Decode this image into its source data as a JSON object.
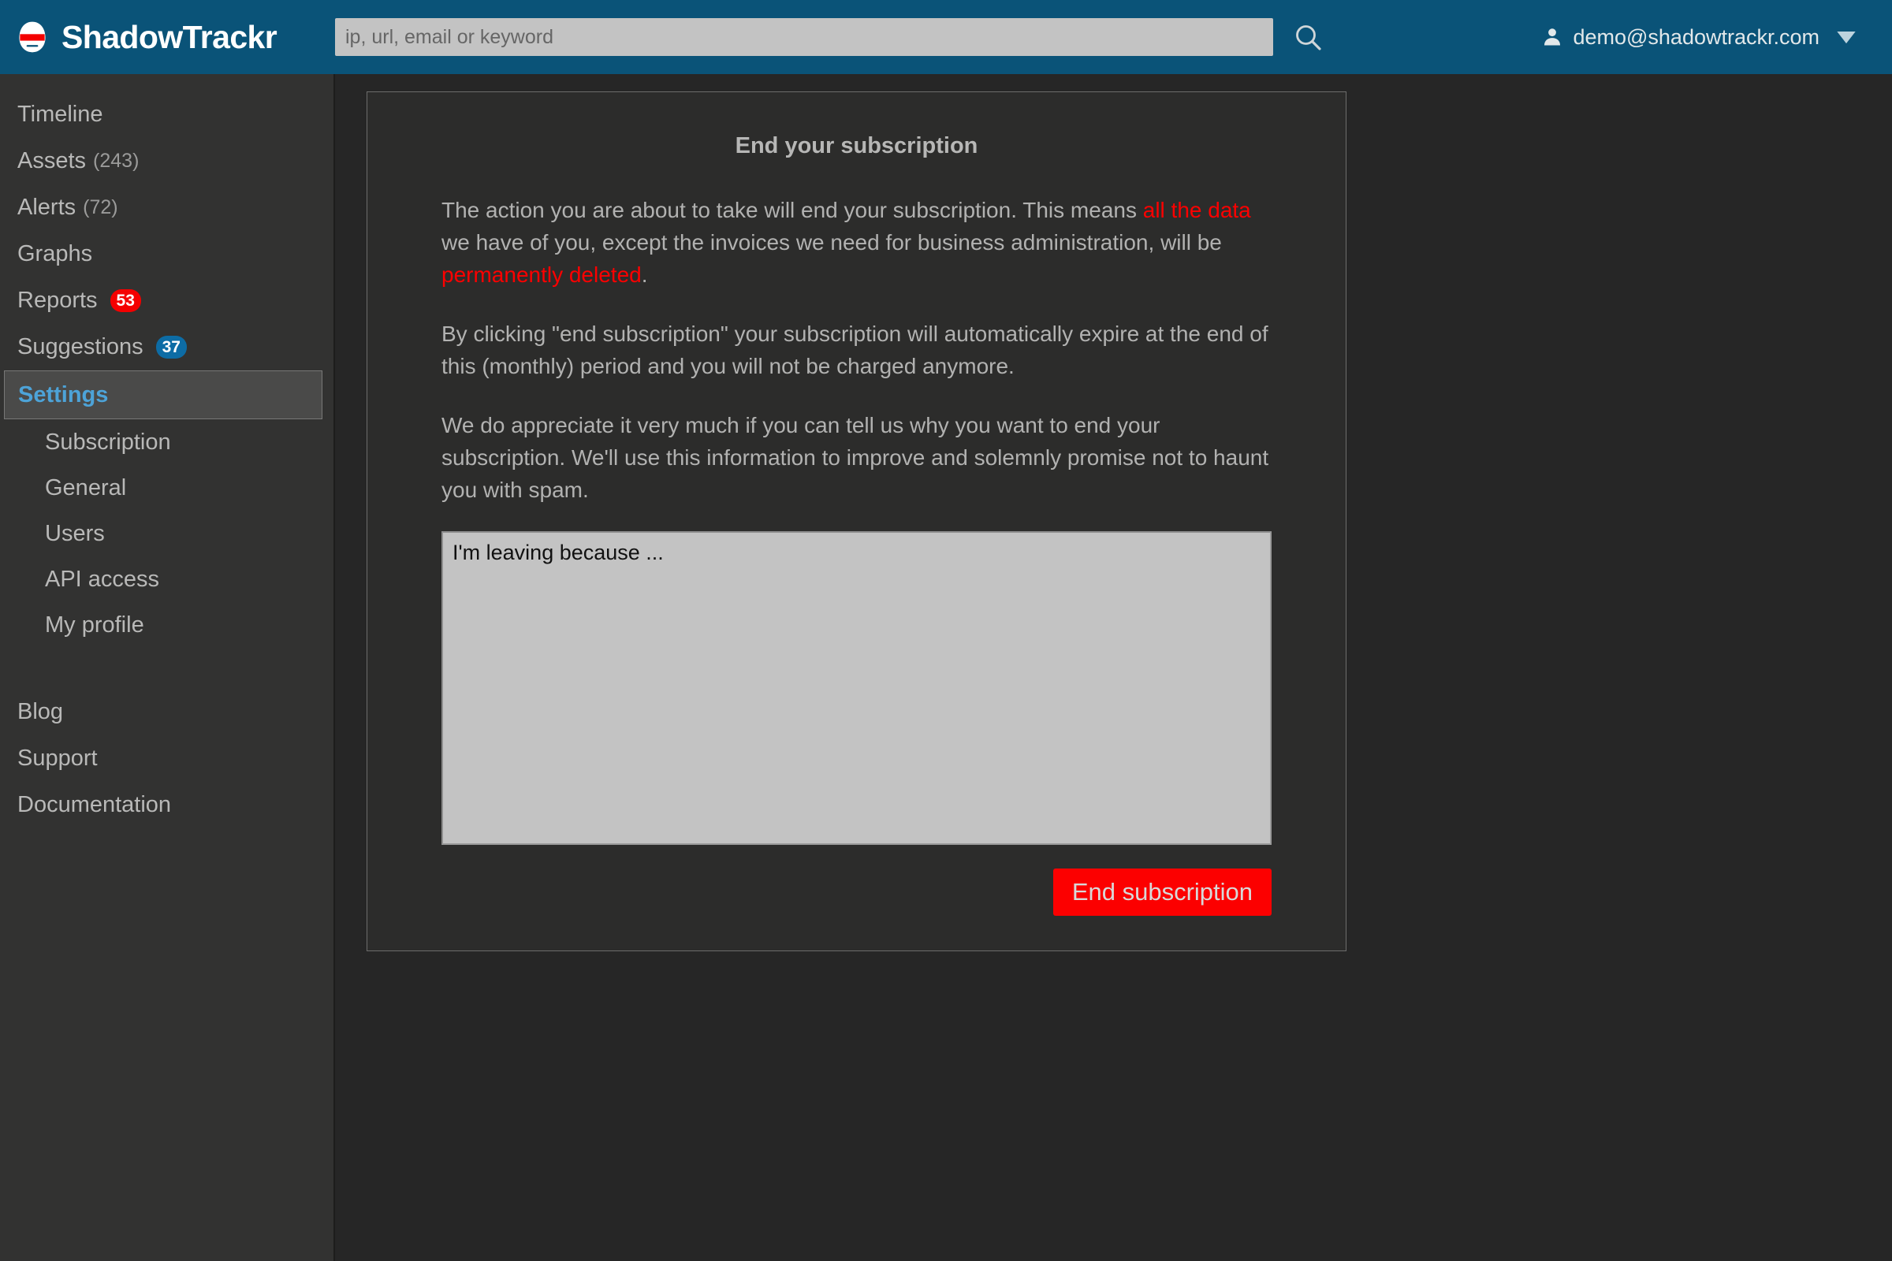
{
  "brand": {
    "name": "ShadowTrackr",
    "logo_icon": "helmet-logo-icon",
    "logo_colors": {
      "face": "#ffffff",
      "visor": "#f40000",
      "background": "#0a5378"
    }
  },
  "topbar": {
    "background": "#0a5378",
    "search": {
      "placeholder": "ip, url, email or keyword",
      "value": "",
      "icon": "search-icon"
    },
    "user": {
      "icon": "user-icon",
      "email": "demo@shadowtrackr.com",
      "caret": "chevron-down-icon"
    }
  },
  "sidebar": {
    "items": [
      {
        "label": "Timeline",
        "count": "",
        "badge": null
      },
      {
        "label": "Assets",
        "count": "(243)",
        "badge": null
      },
      {
        "label": "Alerts",
        "count": "(72)",
        "badge": null
      },
      {
        "label": "Graphs",
        "count": "",
        "badge": null
      },
      {
        "label": "Reports",
        "count": "",
        "badge": "53",
        "badge_color": "red"
      },
      {
        "label": "Suggestions",
        "count": "",
        "badge": "37",
        "badge_color": "blue"
      }
    ],
    "selected": {
      "label": "Settings",
      "color": "#4da3d8"
    },
    "sub_items": [
      {
        "label": "Subscription"
      },
      {
        "label": "General"
      },
      {
        "label": "Users"
      },
      {
        "label": "API access"
      },
      {
        "label": "My profile"
      }
    ],
    "footer_items": [
      {
        "label": "Blog"
      },
      {
        "label": "Support"
      },
      {
        "label": "Documentation"
      }
    ]
  },
  "main": {
    "card": {
      "title": "End your subscription",
      "paragraph1": {
        "part1": "The action you are about to take will end your subscription. This means ",
        "danger1": "all the data",
        "part2": " we have of you, except the invoices we need for business administration, will be ",
        "danger2": "permanently deleted",
        "part3": "."
      },
      "paragraph2": "By clicking \"end subscription\" your subscription will automatically expire at the end of this (monthly) period and you will not be charged anymore.",
      "paragraph3": "We do appreciate it very much if you can tell us why you want to end your subscription. We'll use this information to improve and solemnly promise not to haunt you with spam.",
      "feedback": {
        "placeholder": "I'm leaving because ...",
        "value": ""
      },
      "submit_label": "End subscription",
      "submit_color": "#fc0000"
    }
  }
}
